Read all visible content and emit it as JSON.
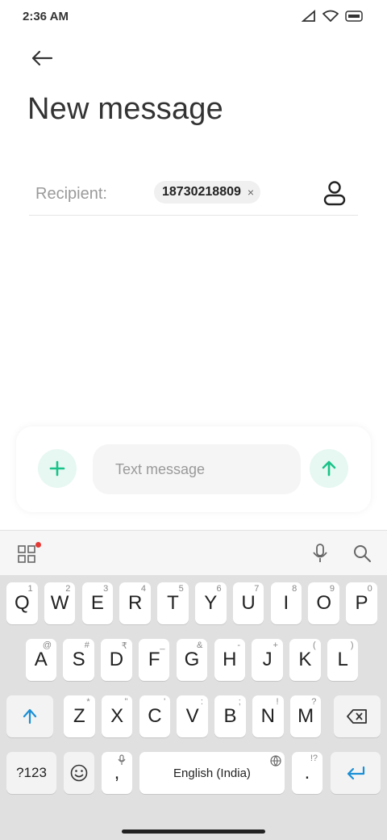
{
  "status_bar": {
    "time": "2:36 AM",
    "icons": [
      "signal-icon",
      "wifi-icon",
      "battery-icon"
    ]
  },
  "header": {
    "back_icon": "back-arrow-icon",
    "title": "New message"
  },
  "recipient": {
    "label": "Recipient:",
    "chip_number": "18730218809",
    "chip_remove": "×",
    "contact_icon": "contact-icon"
  },
  "composer": {
    "placeholder": "Text message",
    "value": "",
    "add_icon": "plus-icon",
    "send_icon": "arrow-up-icon"
  },
  "keyboard": {
    "row1": [
      {
        "k": "Q",
        "h": "1"
      },
      {
        "k": "W",
        "h": "2"
      },
      {
        "k": "E",
        "h": "3"
      },
      {
        "k": "R",
        "h": "4"
      },
      {
        "k": "T",
        "h": "5"
      },
      {
        "k": "Y",
        "h": "6"
      },
      {
        "k": "U",
        "h": "7"
      },
      {
        "k": "I",
        "h": "8"
      },
      {
        "k": "O",
        "h": "9"
      },
      {
        "k": "P",
        "h": "0"
      }
    ],
    "row2": [
      {
        "k": "A",
        "h": "@"
      },
      {
        "k": "S",
        "h": "#"
      },
      {
        "k": "D",
        "h": "₹"
      },
      {
        "k": "F",
        "h": "_"
      },
      {
        "k": "G",
        "h": "&"
      },
      {
        "k": "H",
        "h": "-"
      },
      {
        "k": "J",
        "h": "+"
      },
      {
        "k": "K",
        "h": "("
      },
      {
        "k": "L",
        "h": ")"
      }
    ],
    "row3": [
      {
        "k": "Z",
        "h": "*"
      },
      {
        "k": "X",
        "h": "\""
      },
      {
        "k": "C",
        "h": "'"
      },
      {
        "k": "V",
        "h": ":"
      },
      {
        "k": "B",
        "h": ";"
      },
      {
        "k": "N",
        "h": "!"
      },
      {
        "k": "M",
        "h": "?"
      }
    ],
    "symbols_label": "?123",
    "comma": ",",
    "space_label": "English (India)",
    "period": ".",
    "period_hint": "!?",
    "accent_color": "#1a8fd6",
    "green_accent": "#19c389"
  }
}
